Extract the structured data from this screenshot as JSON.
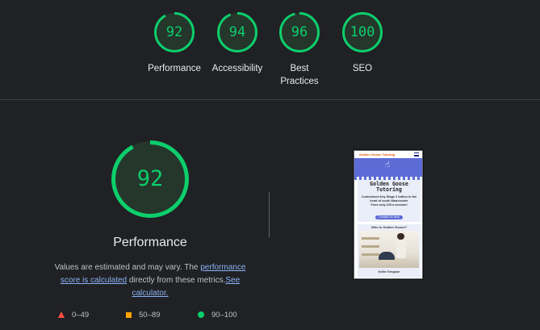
{
  "summary": {
    "gauges": [
      {
        "score": "92",
        "label": "Performance",
        "fraction": 0.92
      },
      {
        "score": "94",
        "label": "Accessibility",
        "fraction": 0.94
      },
      {
        "score": "96",
        "label": "Best Practices",
        "fraction": 0.96
      },
      {
        "score": "100",
        "label": "SEO",
        "fraction": 1.0
      }
    ]
  },
  "performance": {
    "score": "92",
    "fraction": 0.92,
    "title": "Performance",
    "desc_prefix": "Values are estimated and may vary. The ",
    "desc_link1": "performance score is calculated",
    "desc_middle": " directly from these metrics.",
    "desc_link2": "See calculator."
  },
  "legend": {
    "fail": "0–49",
    "average": "50–89",
    "pass": "90–100"
  },
  "colors": {
    "pass": "#0cce6b",
    "pass_bg": "#25362b",
    "average": "#ffa400",
    "fail": "#ff4e42",
    "background": "#202124",
    "link": "#8ab4f8"
  },
  "thumbnail": {
    "header_text": "Golden Goose Tutoring",
    "title": "Golden Goose Tutoring",
    "subtitle": "Customised Key Stage 2 tuition in the heart of south Manchester",
    "price": "From only £25 a session!",
    "button": "Contact Us Now",
    "section_title": "Who is Golden Goose?",
    "caption": "Kellie Gregson"
  },
  "icons": {
    "fail": "triangle-icon",
    "average": "square-icon",
    "pass": "circle-icon",
    "hand": "pointing-hand-icon",
    "menu": "hamburger-menu-icon"
  }
}
